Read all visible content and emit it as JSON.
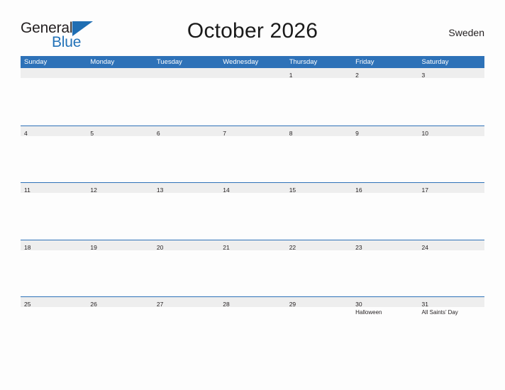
{
  "logo": {
    "text_top": "General",
    "text_bottom": "Blue",
    "triangle_color": "#1f6eb3",
    "blue_color": "#2272b8",
    "icon": "triangle-icon"
  },
  "header": {
    "title": "October 2026",
    "country": "Sweden"
  },
  "theme": {
    "header_blue": "#2e72b8",
    "band_gray": "#eeeeee",
    "page_bg": "#fdfdfd",
    "text": "#231f20"
  },
  "calendar": {
    "weekdays": [
      "Sunday",
      "Monday",
      "Tuesday",
      "Wednesday",
      "Thursday",
      "Friday",
      "Saturday"
    ],
    "weeks": [
      [
        {
          "num": "",
          "events": []
        },
        {
          "num": "",
          "events": []
        },
        {
          "num": "",
          "events": []
        },
        {
          "num": "",
          "events": []
        },
        {
          "num": "1",
          "events": []
        },
        {
          "num": "2",
          "events": []
        },
        {
          "num": "3",
          "events": []
        }
      ],
      [
        {
          "num": "4",
          "events": []
        },
        {
          "num": "5",
          "events": []
        },
        {
          "num": "6",
          "events": []
        },
        {
          "num": "7",
          "events": []
        },
        {
          "num": "8",
          "events": []
        },
        {
          "num": "9",
          "events": []
        },
        {
          "num": "10",
          "events": []
        }
      ],
      [
        {
          "num": "11",
          "events": []
        },
        {
          "num": "12",
          "events": []
        },
        {
          "num": "13",
          "events": []
        },
        {
          "num": "14",
          "events": []
        },
        {
          "num": "15",
          "events": []
        },
        {
          "num": "16",
          "events": []
        },
        {
          "num": "17",
          "events": []
        }
      ],
      [
        {
          "num": "18",
          "events": []
        },
        {
          "num": "19",
          "events": []
        },
        {
          "num": "20",
          "events": []
        },
        {
          "num": "21",
          "events": []
        },
        {
          "num": "22",
          "events": []
        },
        {
          "num": "23",
          "events": []
        },
        {
          "num": "24",
          "events": []
        }
      ],
      [
        {
          "num": "25",
          "events": []
        },
        {
          "num": "26",
          "events": []
        },
        {
          "num": "27",
          "events": []
        },
        {
          "num": "28",
          "events": []
        },
        {
          "num": "29",
          "events": []
        },
        {
          "num": "30",
          "events": [
            "Halloween"
          ]
        },
        {
          "num": "31",
          "events": [
            "All Saints’ Day"
          ]
        }
      ]
    ]
  }
}
